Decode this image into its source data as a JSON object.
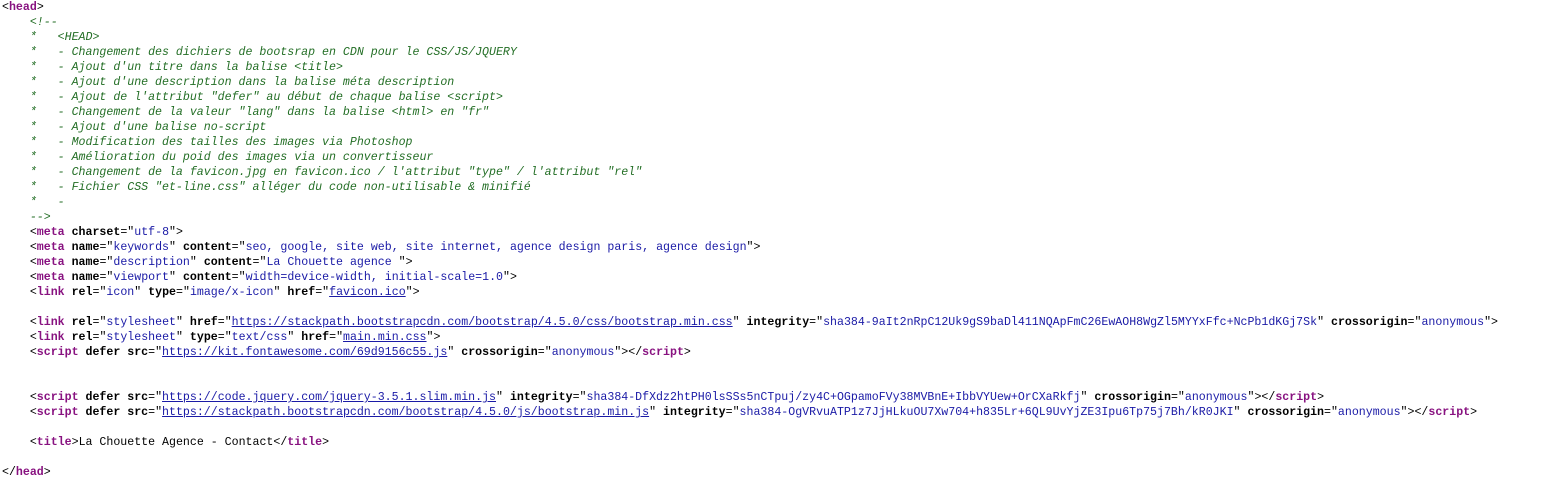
{
  "lines": [
    [
      {
        "t": "<",
        "c": "punct"
      },
      {
        "t": "head",
        "c": "tag"
      },
      {
        "t": ">",
        "c": "punct"
      }
    ],
    [
      {
        "t": "    <!--",
        "c": "comment"
      }
    ],
    [
      {
        "t": "    *   <HEAD>",
        "c": "comment"
      }
    ],
    [
      {
        "t": "    *   - Changement des dichiers de bootsrap en CDN pour le CSS/JS/JQUERY",
        "c": "comment"
      }
    ],
    [
      {
        "t": "    *   - Ajout d'un titre dans la balise <title>",
        "c": "comment"
      }
    ],
    [
      {
        "t": "    *   - Ajout d'une description dans la balise méta description",
        "c": "comment"
      }
    ],
    [
      {
        "t": "    *   - Ajout de l'attribut \"defer\" au début de chaque balise <script>",
        "c": "comment"
      }
    ],
    [
      {
        "t": "    *   - Changement de la valeur \"lang\" dans la balise <html> en \"fr\"",
        "c": "comment"
      }
    ],
    [
      {
        "t": "    *   - Ajout d'une balise no-script",
        "c": "comment"
      }
    ],
    [
      {
        "t": "    *   - Modification des tailles des images via Photoshop",
        "c": "comment"
      }
    ],
    [
      {
        "t": "    *   - Amélioration du poid des images via un convertisseur",
        "c": "comment"
      }
    ],
    [
      {
        "t": "    *   - Changement de la favicon.jpg en favicon.ico / l'attribut \"type\" / l'attribut \"rel\"",
        "c": "comment"
      }
    ],
    [
      {
        "t": "    *   - Fichier CSS \"et-line.css\" alléger du code non-utilisable & minifié",
        "c": "comment"
      }
    ],
    [
      {
        "t": "    *   -",
        "c": "comment"
      }
    ],
    [
      {
        "t": "    -->",
        "c": "comment"
      }
    ],
    [
      {
        "t": "    <",
        "c": "punct"
      },
      {
        "t": "meta",
        "c": "tag"
      },
      {
        "t": " charset",
        "c": "attr"
      },
      {
        "t": "=\"",
        "c": "punct"
      },
      {
        "t": "utf-8",
        "c": "val"
      },
      {
        "t": "\">",
        "c": "punct"
      }
    ],
    [
      {
        "t": "    <",
        "c": "punct"
      },
      {
        "t": "meta",
        "c": "tag"
      },
      {
        "t": " name",
        "c": "attr"
      },
      {
        "t": "=\"",
        "c": "punct"
      },
      {
        "t": "keywords",
        "c": "val"
      },
      {
        "t": "\"",
        "c": "punct"
      },
      {
        "t": " content",
        "c": "attr"
      },
      {
        "t": "=\"",
        "c": "punct"
      },
      {
        "t": "seo, google, site web, site internet, agence design paris, agence design",
        "c": "val"
      },
      {
        "t": "\">",
        "c": "punct"
      }
    ],
    [
      {
        "t": "    <",
        "c": "punct"
      },
      {
        "t": "meta",
        "c": "tag"
      },
      {
        "t": " name",
        "c": "attr"
      },
      {
        "t": "=\"",
        "c": "punct"
      },
      {
        "t": "description",
        "c": "val"
      },
      {
        "t": "\"",
        "c": "punct"
      },
      {
        "t": " content",
        "c": "attr"
      },
      {
        "t": "=\"",
        "c": "punct"
      },
      {
        "t": "La Chouette agence ",
        "c": "val"
      },
      {
        "t": "\">",
        "c": "punct"
      }
    ],
    [
      {
        "t": "    <",
        "c": "punct"
      },
      {
        "t": "meta",
        "c": "tag"
      },
      {
        "t": " name",
        "c": "attr"
      },
      {
        "t": "=\"",
        "c": "punct"
      },
      {
        "t": "viewport",
        "c": "val"
      },
      {
        "t": "\"",
        "c": "punct"
      },
      {
        "t": " content",
        "c": "attr"
      },
      {
        "t": "=\"",
        "c": "punct"
      },
      {
        "t": "width=device-width, initial-scale=1.0",
        "c": "val"
      },
      {
        "t": "\">",
        "c": "punct"
      }
    ],
    [
      {
        "t": "    <",
        "c": "punct"
      },
      {
        "t": "link",
        "c": "tag"
      },
      {
        "t": " rel",
        "c": "attr"
      },
      {
        "t": "=\"",
        "c": "punct"
      },
      {
        "t": "icon",
        "c": "val"
      },
      {
        "t": "\"",
        "c": "punct"
      },
      {
        "t": " type",
        "c": "attr"
      },
      {
        "t": "=\"",
        "c": "punct"
      },
      {
        "t": "image/x-icon",
        "c": "val"
      },
      {
        "t": "\"",
        "c": "punct"
      },
      {
        "t": " href",
        "c": "attr"
      },
      {
        "t": "=\"",
        "c": "punct"
      },
      {
        "t": "favicon.ico",
        "c": "link"
      },
      {
        "t": "\">",
        "c": "punct"
      }
    ],
    [],
    [
      {
        "t": "    <",
        "c": "punct"
      },
      {
        "t": "link",
        "c": "tag"
      },
      {
        "t": " rel",
        "c": "attr"
      },
      {
        "t": "=\"",
        "c": "punct"
      },
      {
        "t": "stylesheet",
        "c": "val"
      },
      {
        "t": "\"",
        "c": "punct"
      },
      {
        "t": " href",
        "c": "attr"
      },
      {
        "t": "=\"",
        "c": "punct"
      },
      {
        "t": "https://stackpath.bootstrapcdn.com/bootstrap/4.5.0/css/bootstrap.min.css",
        "c": "link"
      },
      {
        "t": "\"",
        "c": "punct"
      },
      {
        "t": " integrity",
        "c": "attr"
      },
      {
        "t": "=\"",
        "c": "punct"
      },
      {
        "t": "sha384-9aIt2nRpC12Uk9gS9baDl411NQApFmC26EwAOH8WgZl5MYYxFfc+NcPb1dKGj7Sk",
        "c": "val"
      },
      {
        "t": "\"",
        "c": "punct"
      },
      {
        "t": " crossorigin",
        "c": "attr"
      },
      {
        "t": "=\"",
        "c": "punct"
      },
      {
        "t": "anonymous",
        "c": "val"
      },
      {
        "t": "\">",
        "c": "punct"
      }
    ],
    [
      {
        "t": "    <",
        "c": "punct"
      },
      {
        "t": "link",
        "c": "tag"
      },
      {
        "t": " rel",
        "c": "attr"
      },
      {
        "t": "=\"",
        "c": "punct"
      },
      {
        "t": "stylesheet",
        "c": "val"
      },
      {
        "t": "\"",
        "c": "punct"
      },
      {
        "t": " type",
        "c": "attr"
      },
      {
        "t": "=\"",
        "c": "punct"
      },
      {
        "t": "text/css",
        "c": "val"
      },
      {
        "t": "\"",
        "c": "punct"
      },
      {
        "t": " href",
        "c": "attr"
      },
      {
        "t": "=\"",
        "c": "punct"
      },
      {
        "t": "main.min.css",
        "c": "link"
      },
      {
        "t": "\">",
        "c": "punct"
      }
    ],
    [
      {
        "t": "    <",
        "c": "punct"
      },
      {
        "t": "script",
        "c": "tag"
      },
      {
        "t": " defer src",
        "c": "attr"
      },
      {
        "t": "=\"",
        "c": "punct"
      },
      {
        "t": "https://kit.fontawesome.com/69d9156c55.js",
        "c": "link"
      },
      {
        "t": "\"",
        "c": "punct"
      },
      {
        "t": " crossorigin",
        "c": "attr"
      },
      {
        "t": "=\"",
        "c": "punct"
      },
      {
        "t": "anonymous",
        "c": "val"
      },
      {
        "t": "\"></",
        "c": "punct"
      },
      {
        "t": "script",
        "c": "tag"
      },
      {
        "t": ">",
        "c": "punct"
      }
    ],
    [],
    [],
    [
      {
        "t": "    <",
        "c": "punct"
      },
      {
        "t": "script",
        "c": "tag"
      },
      {
        "t": " defer src",
        "c": "attr"
      },
      {
        "t": "=\"",
        "c": "punct"
      },
      {
        "t": "https://code.jquery.com/jquery-3.5.1.slim.min.js",
        "c": "link"
      },
      {
        "t": "\"",
        "c": "punct"
      },
      {
        "t": " integrity",
        "c": "attr"
      },
      {
        "t": "=\"",
        "c": "punct"
      },
      {
        "t": "sha384-DfXdz2htPH0lsSSs5nCTpuj/zy4C+OGpamoFVy38MVBnE+IbbVYUew+OrCXaRkfj",
        "c": "val"
      },
      {
        "t": "\"",
        "c": "punct"
      },
      {
        "t": " crossorigin",
        "c": "attr"
      },
      {
        "t": "=\"",
        "c": "punct"
      },
      {
        "t": "anonymous",
        "c": "val"
      },
      {
        "t": "\"></",
        "c": "punct"
      },
      {
        "t": "script",
        "c": "tag"
      },
      {
        "t": ">",
        "c": "punct"
      }
    ],
    [
      {
        "t": "    <",
        "c": "punct"
      },
      {
        "t": "script",
        "c": "tag"
      },
      {
        "t": " defer src",
        "c": "attr"
      },
      {
        "t": "=\"",
        "c": "punct"
      },
      {
        "t": "https://stackpath.bootstrapcdn.com/bootstrap/4.5.0/js/bootstrap.min.js",
        "c": "link"
      },
      {
        "t": "\"",
        "c": "punct"
      },
      {
        "t": " integrity",
        "c": "attr"
      },
      {
        "t": "=\"",
        "c": "punct"
      },
      {
        "t": "sha384-OgVRvuATP1z7JjHLkuOU7Xw704+h835Lr+6QL9UvYjZE3Ipu6Tp75j7Bh/kR0JKI",
        "c": "val"
      },
      {
        "t": "\"",
        "c": "punct"
      },
      {
        "t": " crossorigin",
        "c": "attr"
      },
      {
        "t": "=\"",
        "c": "punct"
      },
      {
        "t": "anonymous",
        "c": "val"
      },
      {
        "t": "\"></",
        "c": "punct"
      },
      {
        "t": "script",
        "c": "tag"
      },
      {
        "t": ">",
        "c": "punct"
      }
    ],
    [],
    [
      {
        "t": "    <",
        "c": "punct"
      },
      {
        "t": "title",
        "c": "tag"
      },
      {
        "t": ">",
        "c": "punct"
      },
      {
        "t": "La Chouette Agence - Contact",
        "c": "text"
      },
      {
        "t": "</",
        "c": "punct"
      },
      {
        "t": "title",
        "c": "tag"
      },
      {
        "t": ">",
        "c": "punct"
      }
    ],
    [],
    [
      {
        "t": "</",
        "c": "punct"
      },
      {
        "t": "head",
        "c": "tag"
      },
      {
        "t": ">",
        "c": "punct"
      }
    ]
  ]
}
